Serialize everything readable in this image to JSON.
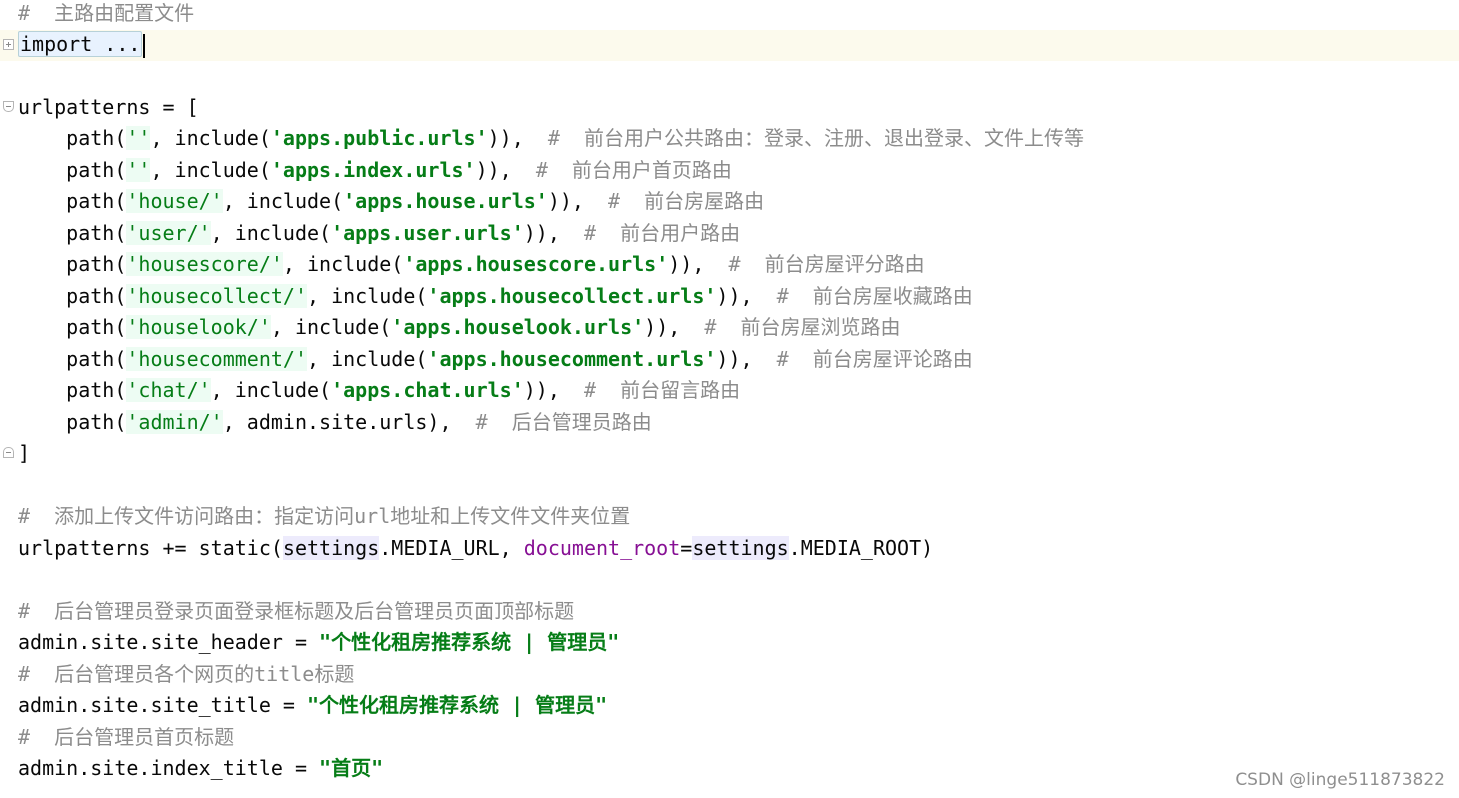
{
  "editor": {
    "file_comment": "#  主路由配置文件",
    "import_folded": "import ...",
    "urlpatterns_open": "urlpatterns = [",
    "routes": [
      {
        "prefix": "''",
        "include": "'apps.public.urls'",
        "comment": "#  前台用户公共路由：登录、注册、退出登录、文件上传等"
      },
      {
        "prefix": "''",
        "include": "'apps.index.urls'",
        "comment": "#  前台用户首页路由"
      },
      {
        "prefix": "'house/'",
        "include": "'apps.house.urls'",
        "comment": "#  前台房屋路由"
      },
      {
        "prefix": "'user/'",
        "include": "'apps.user.urls'",
        "comment": "#  前台用户路由"
      },
      {
        "prefix": "'housescore/'",
        "include": "'apps.housescore.urls'",
        "comment": "#  前台房屋评分路由"
      },
      {
        "prefix": "'housecollect/'",
        "include": "'apps.housecollect.urls'",
        "comment": "#  前台房屋收藏路由"
      },
      {
        "prefix": "'houselook/'",
        "include": "'apps.houselook.urls'",
        "comment": "#  前台房屋浏览路由"
      },
      {
        "prefix": "'housecomment/'",
        "include": "'apps.housecomment.urls'",
        "comment": "#  前台房屋评论路由"
      },
      {
        "prefix": "'chat/'",
        "include": "'apps.chat.urls'",
        "comment": "#  前台留言路由"
      }
    ],
    "admin_route": {
      "prefix": "'admin/'",
      "target": "admin.site.urls",
      "comment": "#  后台管理员路由"
    },
    "urlpatterns_close": "]",
    "static_comment": "#  添加上传文件访问路由：指定访问url地址和上传文件文件夹位置",
    "static_line": {
      "lhs": "urlpatterns += static(",
      "settings1": "settings",
      "media_url": ".MEDIA_URL, ",
      "param": "document_root",
      "eq": "=",
      "settings2": "settings",
      "media_root": ".MEDIA_ROOT)"
    },
    "header_comment": "#  后台管理员登录页面登录框标题及后台管理员页面顶部标题",
    "site_header": {
      "lhs": "admin.site.site_header = ",
      "value": "\"个性化租房推荐系统 | 管理员\""
    },
    "title_comment": "#  后台管理员各个网页的title标题",
    "site_title": {
      "lhs": "admin.site.site_title = ",
      "value": "\"个性化租房推荐系统 | 管理员\""
    },
    "index_comment": "#  后台管理员首页标题",
    "index_title": {
      "lhs": "admin.site.index_title = ",
      "value": "\"首页\""
    }
  },
  "watermark": "CSDN @linge511873822",
  "colors": {
    "comment": "#8c8c8c",
    "string": "#067d17",
    "parameter": "#871094",
    "current_line": "#fcfaed"
  }
}
